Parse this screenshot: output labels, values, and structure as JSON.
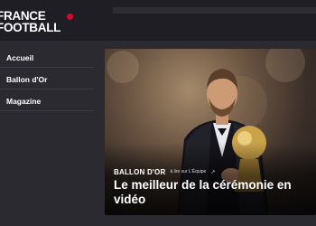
{
  "header": {
    "logo_line1": "FRANCE",
    "logo_line2": "FOOTBALL"
  },
  "sidebar": {
    "items": [
      {
        "label": "Accueil"
      },
      {
        "label": "Ballon d'Or"
      },
      {
        "label": "Magazine"
      }
    ]
  },
  "hero": {
    "kicker": "BALLON D'OR",
    "source": "à lire sur L'Équipe",
    "external_icon": "external-link-icon",
    "headline": "Le meilleur de la cérémonie en vidéo"
  },
  "colors": {
    "background": "#2b2a31",
    "topbar": "#1f1e24",
    "accent": "#e4002b"
  }
}
